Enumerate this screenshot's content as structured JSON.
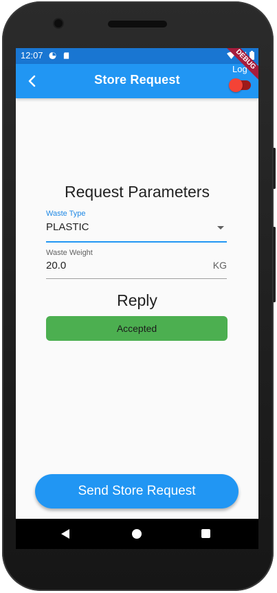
{
  "status_bar": {
    "time": "12:07",
    "icons": [
      "data-saver-icon",
      "sd-card-icon",
      "wifi-icon",
      "signal-icon",
      "battery-icon"
    ]
  },
  "app_bar": {
    "title": "Store Request",
    "log_label": "Log",
    "log_toggle_on": true,
    "debug_banner": "DEBUG"
  },
  "form": {
    "section_title": "Request Parameters",
    "waste_type": {
      "label": "Waste Type",
      "value": "PLASTIC"
    },
    "waste_weight": {
      "label": "Waste Weight",
      "value": "20.0",
      "unit": "KG"
    }
  },
  "reply": {
    "title": "Reply",
    "status": "Accepted",
    "status_color": "#4caf50"
  },
  "actions": {
    "send_label": "Send Store Request"
  },
  "colors": {
    "primary": "#2196f3",
    "status_bar": "#1976d2",
    "toggle_active": "#f44336"
  }
}
